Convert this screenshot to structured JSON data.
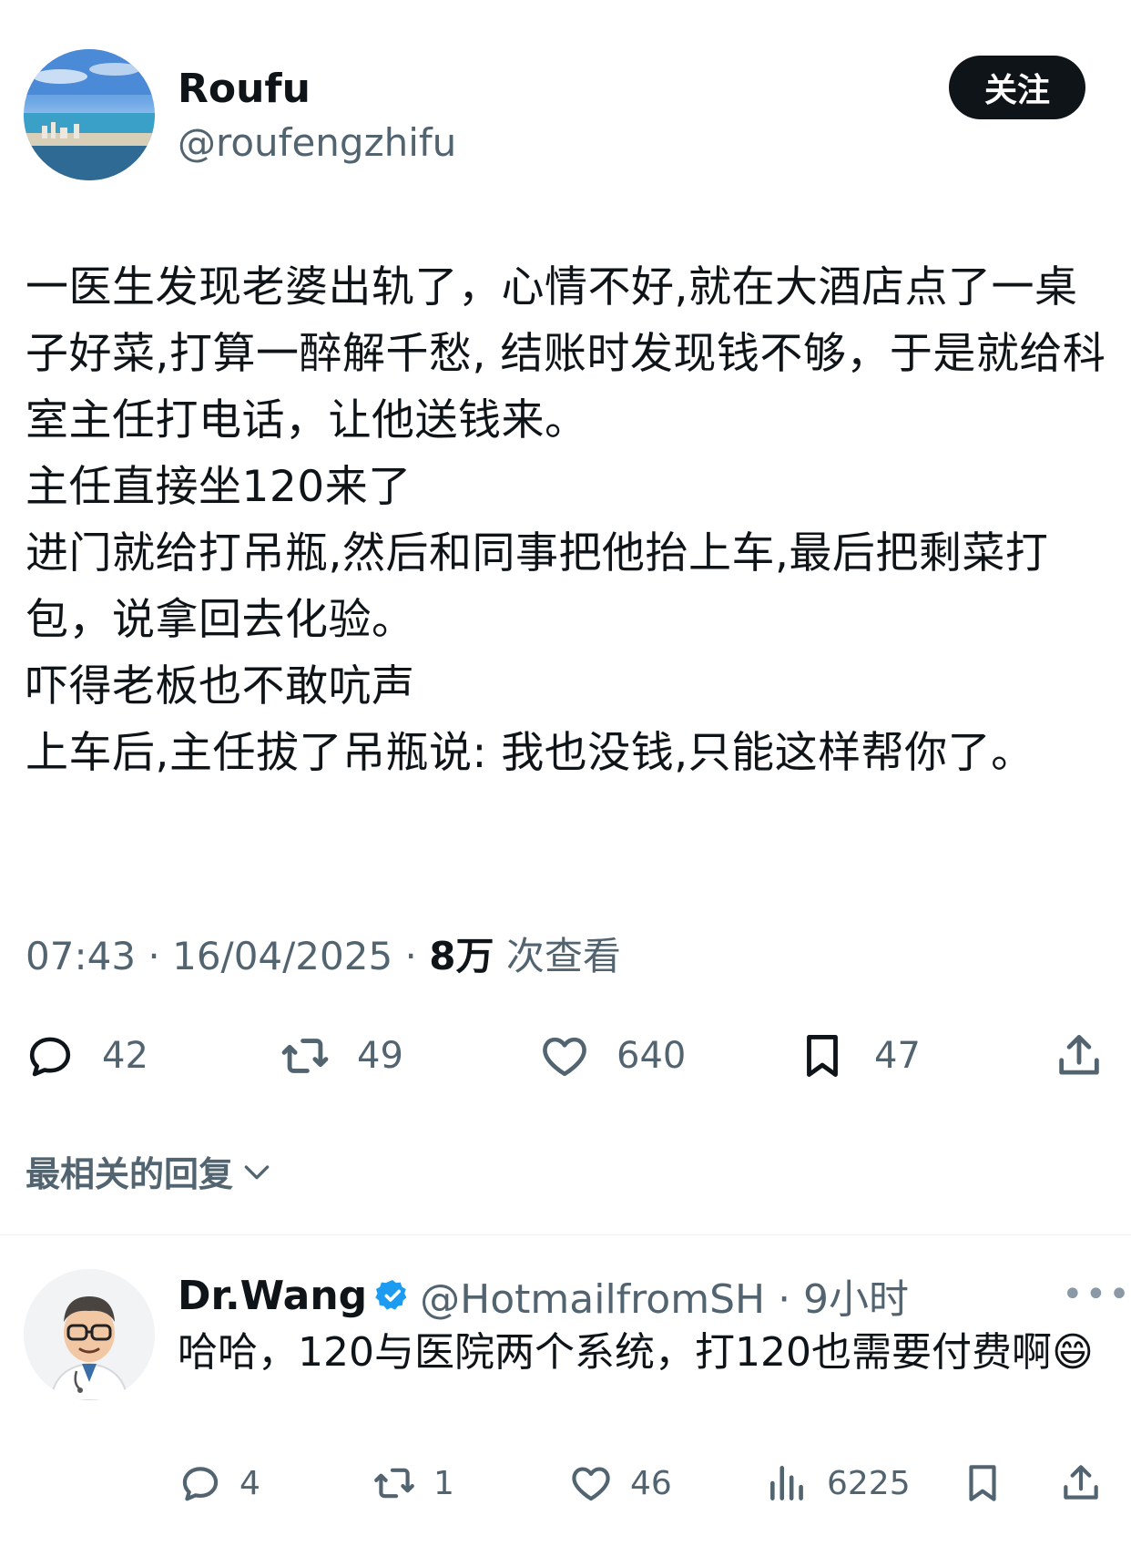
{
  "tweet": {
    "author_name": "Roufu",
    "author_handle": "@roufengzhifu",
    "follow_label": "关注",
    "text": "一医生发现老婆出轨了，心情不好,就在大酒店点了一桌子好菜,打算一醉解千愁, 结账时发现钱不够，于是就给科室主任打电话，让他送钱来。\n主任直接坐120来了\n进门就给打吊瓶,然后和同事把他抬上车,最后把剩菜打包，说拿回去化验。\n吓得老板也不敢吭声\n上车后,主任拔了吊瓶说: 我也没钱,只能这样帮你了。",
    "time": "07:43",
    "date": "16/04/2025",
    "views": "8万",
    "views_label": "次查看",
    "separator": " · ",
    "actions": {
      "reply_count": "42",
      "retweet_count": "49",
      "like_count": "640",
      "bookmark_count": "47"
    }
  },
  "replies_header": "最相关的回复",
  "reply": {
    "name": "Dr.Wang",
    "handle": "@HotmailfromSH · 9小时",
    "more": "•••",
    "text": "哈哈，120与医院两个系统，打120也需要付费啊😄",
    "actions": {
      "reply_count": "4",
      "retweet_count": "1",
      "like_count": "46",
      "views_count": "6225"
    }
  },
  "colors": {
    "text": "#0f1419",
    "secondary": "#536471",
    "verified": "#1d9bf0",
    "button_bg": "#0f1419"
  },
  "icons": [
    "reply-icon",
    "retweet-icon",
    "like-icon",
    "bookmark-icon",
    "share-icon",
    "views-icon",
    "verified-badge-icon",
    "chevron-down-icon",
    "more-icon"
  ]
}
